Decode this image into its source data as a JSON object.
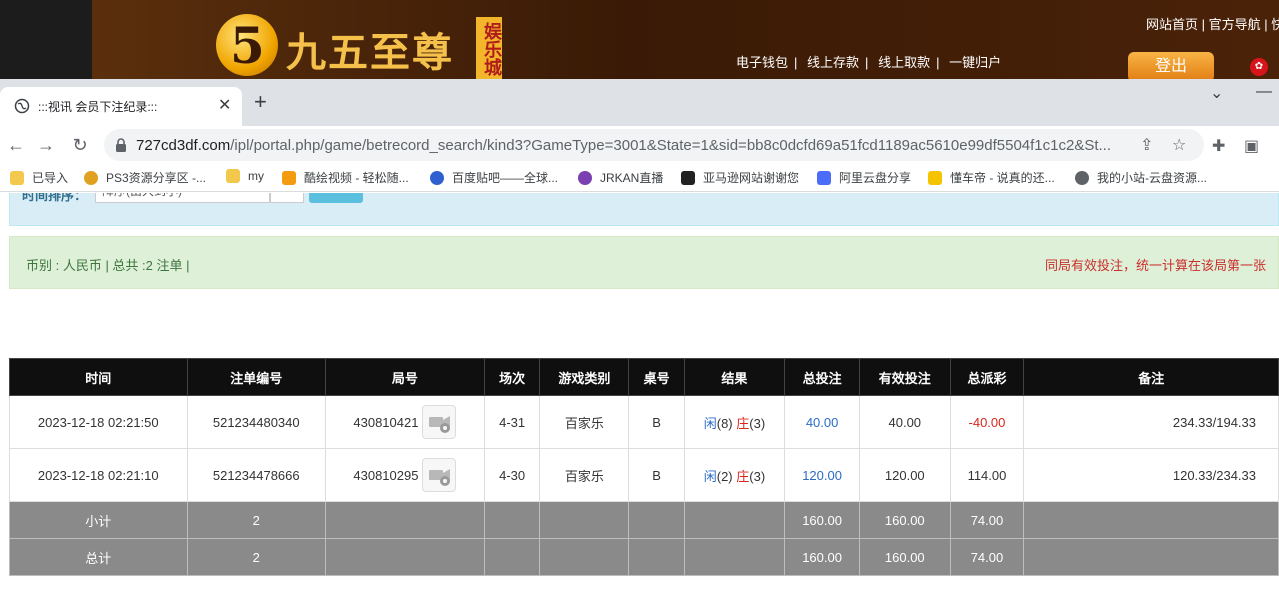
{
  "site": {
    "logo_glyph": "5",
    "logo_text": "九五至尊",
    "logo_sub": "娱乐城",
    "top_links": "网站首页 | 官方导航 | 快",
    "nav": [
      "电子钱包",
      "线上存款",
      "线上取款",
      "一键归户"
    ],
    "login": "登出"
  },
  "browser": {
    "tab_title": ":::视讯 会员下注纪录:::",
    "new_tab": "+",
    "url_host": "727cd3df.com",
    "url_path": "/ipl/portal.php/game/betrecord_search/kind3?GameType=3001&State=1&sid=bb8c0dcfd69a51fcd1189ac5610e99df5504f1c1c2&St...",
    "bookmarks": [
      {
        "label": "已导入",
        "icon": "folder-icon",
        "color": "#f2c94c"
      },
      {
        "label": "PS3资源分享区 -...",
        "icon": "bee-icon",
        "color": "#e0a020"
      },
      {
        "label": "my",
        "icon": "folder-icon",
        "color": "#f2c94c"
      },
      {
        "label": "酷绘视频 - 轻松随...",
        "icon": "k-logo-icon",
        "color": "#f39c12"
      },
      {
        "label": "百度贴吧——全球...",
        "icon": "paw-icon",
        "color": "#3060d0"
      },
      {
        "label": "JRKAN直播",
        "icon": "jrkan-icon",
        "color": "#7a3fb0"
      },
      {
        "label": "亚马逊网站谢谢您",
        "icon": "amazon-icon",
        "color": "#222222"
      },
      {
        "label": "阿里云盘分享",
        "icon": "aliyun-icon",
        "color": "#4a6cf7"
      },
      {
        "label": "懂车帝 - 说真的还...",
        "icon": "dongchedi-icon",
        "color": "#f5c400"
      },
      {
        "label": "我的小站-云盘资源...",
        "icon": "globe-icon",
        "color": "#5f6368"
      }
    ]
  },
  "filter": {
    "label": "时间排序：",
    "select_value": "降序(由大到小)",
    "button": "查询"
  },
  "info": {
    "left": "币别 : 人民币 | 总共 :2 注单 |",
    "right": "同局有效投注，统一计算在该局第一张"
  },
  "table": {
    "headers": [
      "时间",
      "注单编号",
      "局号",
      "场次",
      "游戏类别",
      "桌号",
      "结果",
      "总投注",
      "有效投注",
      "总派彩",
      "备注"
    ],
    "rows": [
      {
        "time": "2023-12-18 02:21:50",
        "bet_id": "521234480340",
        "round": "430810421",
        "session": "4-31",
        "game": "百家乐",
        "table": "B",
        "result_player_label": "闲",
        "result_player": "(8)",
        "result_banker_label": "庄",
        "result_banker": "(3)",
        "total_bet": "40.00",
        "valid_bet": "40.00",
        "payout": "-40.00",
        "note": "234.33/194.33"
      },
      {
        "time": "2023-12-18 02:21:10",
        "bet_id": "521234478666",
        "round": "430810295",
        "session": "4-30",
        "game": "百家乐",
        "table": "B",
        "result_player_label": "闲",
        "result_player": "(2)",
        "result_banker_label": "庄",
        "result_banker": "(3)",
        "total_bet": "120.00",
        "valid_bet": "120.00",
        "payout": "114.00",
        "note": "120.33/234.33"
      }
    ],
    "subtotal": {
      "label": "小计",
      "count": "2",
      "total_bet": "160.00",
      "valid_bet": "160.00",
      "payout": "74.00"
    },
    "grandtotal": {
      "label": "总计",
      "count": "2",
      "total_bet": "160.00",
      "valid_bet": "160.00",
      "payout": "74.00"
    }
  },
  "colors": {
    "header_bg": "#0f0f0f",
    "sum_bg": "#8a8a8a",
    "link_blue": "#2b6cc4",
    "loss_red": "#d9261c"
  }
}
